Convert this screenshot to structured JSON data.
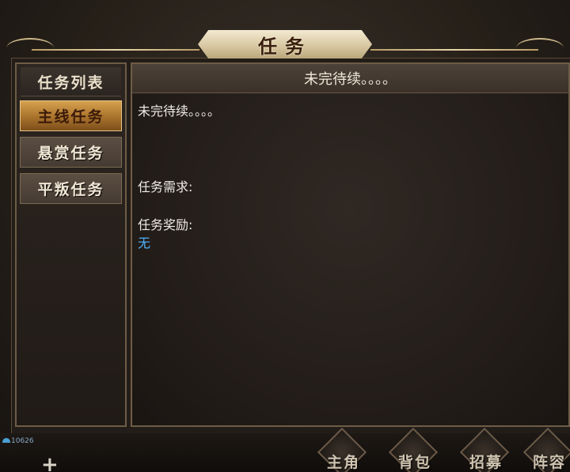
{
  "window_title": "任务",
  "sidebar": {
    "header": "任务列表",
    "tabs": [
      {
        "label": "主线任务",
        "active": true
      },
      {
        "label": "悬赏任务",
        "active": false
      },
      {
        "label": "平叛任务",
        "active": false
      }
    ]
  },
  "detail": {
    "header": "未完待续。。。。",
    "description": "未完待续。。。。",
    "requirements_label": "任务需求:",
    "rewards_label": "任务奖励:",
    "rewards_value": "无"
  },
  "bottom_bar": {
    "counter": "10626",
    "plus": "+",
    "buttons": [
      {
        "label": "主角"
      },
      {
        "label": "背包"
      },
      {
        "label": "招募"
      },
      {
        "label": "阵容"
      }
    ]
  },
  "colors": {
    "accent_gold": "#d6a14e",
    "reward_text": "#4fb3ff",
    "panel_border": "#6e5c45"
  },
  "icons": [
    "close-icon",
    "plus-icon",
    "signal-icon"
  ]
}
